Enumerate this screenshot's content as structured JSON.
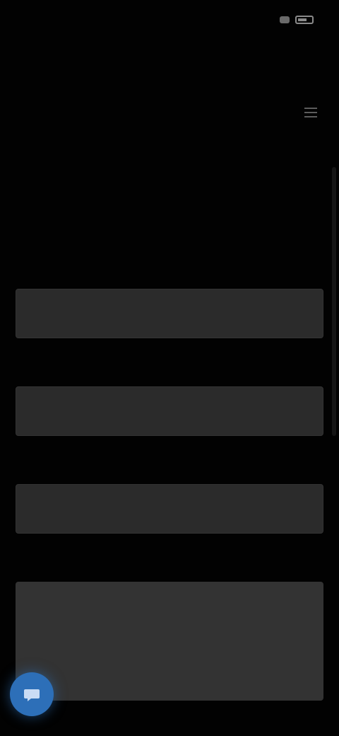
{
  "status_bar": {
    "time": "",
    "signal_icon": "signal-icon",
    "battery_icon": "battery-icon"
  },
  "browser": {
    "url": ""
  },
  "header": {
    "title": "",
    "menu_icon": "menu-icon"
  },
  "intro": {
    "paragraph_1": "",
    "paragraph_2": ""
  },
  "form": {
    "fields": [
      {
        "label": "",
        "placeholder": ""
      },
      {
        "label": "",
        "placeholder": ""
      },
      {
        "label": "",
        "placeholder": ""
      }
    ],
    "message": {
      "label": "",
      "placeholder": ""
    }
  },
  "bottom": {
    "link_text": "",
    "fab_icon": "chat-icon"
  },
  "colors": {
    "background": "#020202",
    "field_background": "#2b2b2b",
    "accent": "#2d6fb8"
  }
}
